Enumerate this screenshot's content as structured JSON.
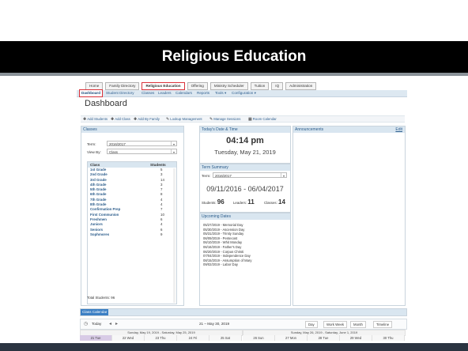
{
  "slide": {
    "title": "Religious Education"
  },
  "topnav": [
    {
      "label": "Home"
    },
    {
      "label": "Family Directory"
    },
    {
      "label": "Religious Education",
      "active": true
    },
    {
      "label": "Offering"
    },
    {
      "label": "Ministry Scheduler"
    },
    {
      "label": "Tuition"
    },
    {
      "label": "IQ"
    },
    {
      "label": "Administration"
    }
  ],
  "subnav": [
    {
      "label": "Dashboard",
      "active": true
    },
    {
      "label": "Student Directory"
    },
    {
      "label": "Classes"
    },
    {
      "label": "Leaders"
    },
    {
      "label": "Calendars"
    },
    {
      "label": "Reports"
    },
    {
      "label": "Tools ▾"
    },
    {
      "label": "Configuration ▾"
    }
  ],
  "page_title": "Dashboard",
  "actions": [
    {
      "label": "Add Students",
      "icon": "✚"
    },
    {
      "label": "Add Class",
      "icon": "✚"
    },
    {
      "label": "Add By Family",
      "icon": "✚"
    },
    {
      "label": "Lookup Management",
      "icon": "✎"
    },
    {
      "label": "Manage Sessions",
      "icon": "✎"
    },
    {
      "label": "Room Calendar",
      "icon": "▦"
    }
  ],
  "classes_panel": {
    "title": "Classes",
    "term_label": "Term:",
    "term_value": "2016/2017",
    "viewby_label": "View By:",
    "viewby_value": "Class",
    "col_class": "Class",
    "col_students": "Students",
    "rows": [
      {
        "name": "1st Grade",
        "count": "5"
      },
      {
        "name": "2nd Grade",
        "count": "3"
      },
      {
        "name": "3rd Grade",
        "count": "14"
      },
      {
        "name": "4th Grade",
        "count": "3"
      },
      {
        "name": "5th Grade",
        "count": "7"
      },
      {
        "name": "6th Grade",
        "count": "8"
      },
      {
        "name": "7th Grade",
        "count": "4"
      },
      {
        "name": "8th Grade",
        "count": "4"
      },
      {
        "name": "Confirmation Prep",
        "count": "7"
      },
      {
        "name": "First Communion",
        "count": "10"
      },
      {
        "name": "Freshmen",
        "count": "6"
      },
      {
        "name": "Juniors",
        "count": "4"
      },
      {
        "name": "Seniors",
        "count": "6"
      },
      {
        "name": "Sophmores",
        "count": "9"
      }
    ],
    "total": "Total Students: 96"
  },
  "datetime_panel": {
    "title": "Today's Date & Time",
    "time": "04:14 pm",
    "date": "Tuesday, May 21, 2019"
  },
  "term_summary": {
    "title": "Term Summary",
    "term_label": "Term:",
    "term_value": "2016/2017",
    "range": "09/11/2016 - 06/04/2017",
    "students_label": "Students:",
    "students": "96",
    "leaders_label": "Leaders:",
    "leaders": "11",
    "classes_label": "Classes:",
    "classes": "14"
  },
  "upcoming": {
    "title": "Upcoming Dates",
    "items": [
      "05/27/2019 - Memorial Day",
      "05/30/2019 - Ascension Day",
      "05/31/2019 - Trinity Sunday",
      "06/09/2019 - Pentecost",
      "06/10/2019 - Whit Monday",
      "06/16/2019 - Father's Day",
      "06/20/2019 - Corpus Christi",
      "07/04/2019 - Independence Day",
      "08/15/2019 - Assumption of Mary",
      "09/02/2019 - Labor Day"
    ]
  },
  "announcements": {
    "title": "Announcements",
    "edit": "Edit"
  },
  "calendar": {
    "title": "Class Calendar",
    "today": "Today",
    "range": "21 – May 30, 2019",
    "views": [
      "Day",
      "Work Week",
      "Month",
      "Timeline"
    ],
    "week1": "Sunday, May 19, 2019 - Saturday, May 25, 2019",
    "week2": "Sunday, May 26, 2019 - Saturday, June 1, 2019",
    "days": [
      "21 Tue",
      "22 Wed",
      "23 Thu",
      "24 Fri",
      "25 Sat",
      "26 Sun",
      "27 Mon",
      "28 Tue",
      "29 Wed",
      "30 Thu"
    ]
  }
}
